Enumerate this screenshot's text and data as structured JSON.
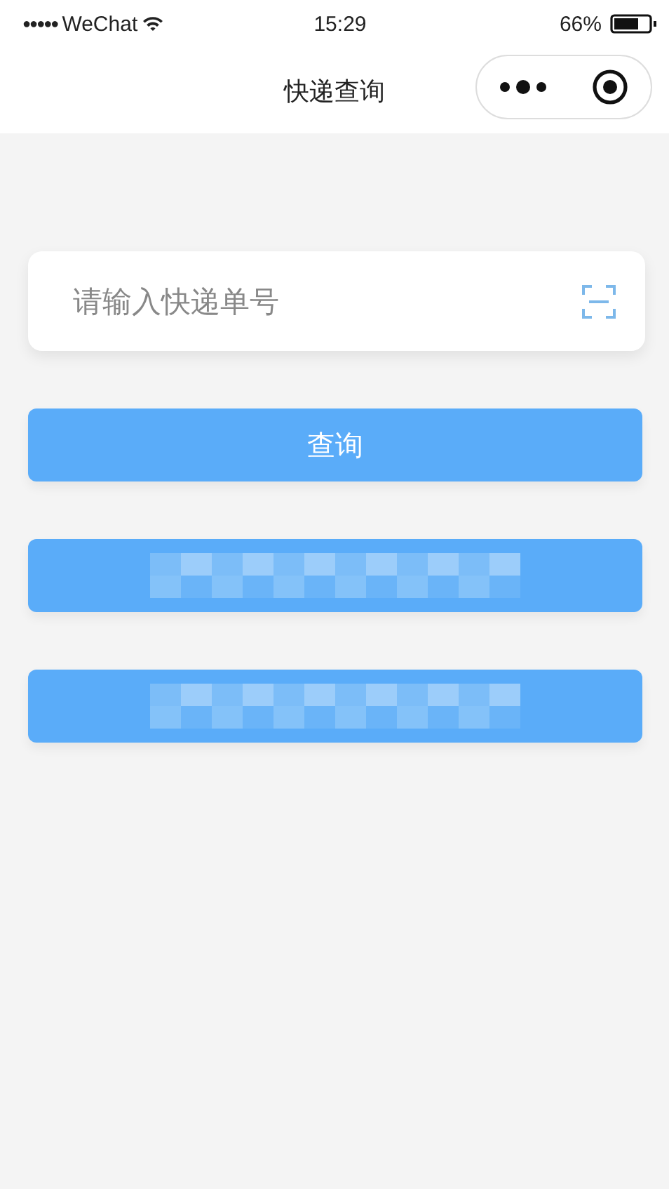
{
  "status_bar": {
    "signal": "●●●●●",
    "carrier": "WeChat",
    "time": "15:29",
    "battery": "66%"
  },
  "nav_bar": {
    "title": "快递查询"
  },
  "search": {
    "placeholder": "请输入快递单号"
  },
  "buttons": [
    {
      "kind": "text",
      "label": "查询"
    },
    {
      "kind": "obscured"
    },
    {
      "kind": "obscured"
    }
  ]
}
